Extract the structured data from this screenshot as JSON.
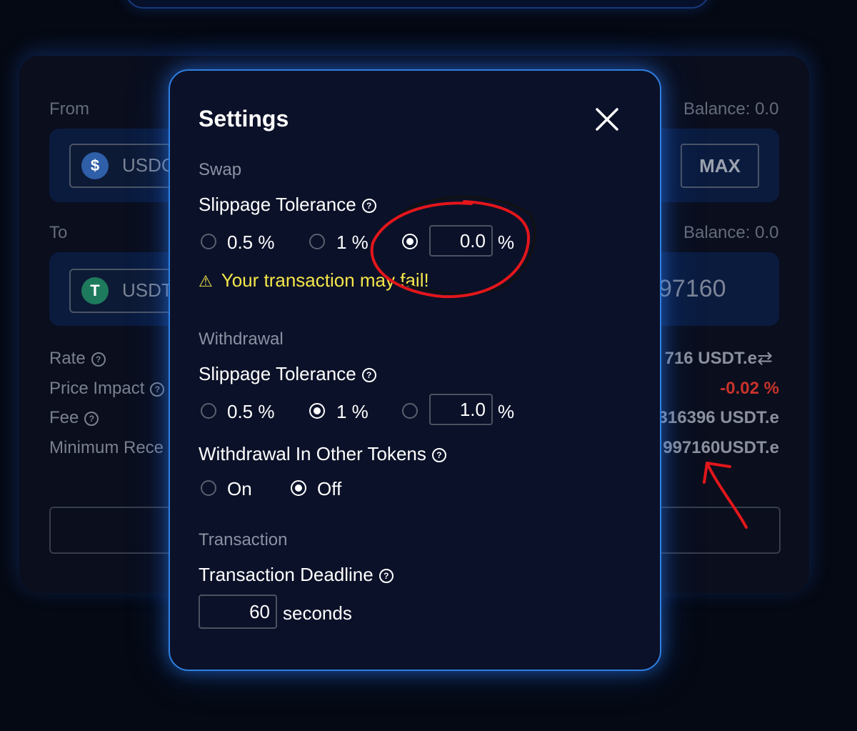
{
  "background_card": {
    "from_label": "From",
    "from_balance": "Balance: 0.0",
    "from_token": "USDC",
    "max_label": "MAX",
    "to_label": "To",
    "to_balance": "Balance: 0.0",
    "to_token": "USDT",
    "to_amount_visible": "97160",
    "rows": [
      {
        "label": "Rate",
        "value": "716 USDT.e"
      },
      {
        "label": "Price Impact",
        "value": "-0.02 %"
      },
      {
        "label": "Fee",
        "value": "316396 USDT.e"
      },
      {
        "label": "Minimum Rece",
        "value": "997160USDT.e"
      }
    ]
  },
  "modal": {
    "title": "Settings",
    "swap": {
      "section": "Swap",
      "label": "Slippage Tolerance",
      "options": [
        "0.5 %",
        "1 %"
      ],
      "selected": "custom",
      "custom_value": "0.0",
      "unit": "%",
      "warning": "Your transaction may fail!"
    },
    "withdrawal": {
      "section": "Withdrawal",
      "label": "Slippage Tolerance",
      "options": [
        "0.5 %",
        "1 %"
      ],
      "selected": "1 %",
      "custom_value": "1.0",
      "unit": "%",
      "other_tokens_label": "Withdrawal In Other Tokens",
      "other_tokens_options": [
        "On",
        "Off"
      ],
      "other_tokens_selected": "Off"
    },
    "transaction": {
      "section": "Transaction",
      "deadline_label": "Transaction Deadline",
      "deadline_value": "60",
      "deadline_unit": "seconds"
    }
  },
  "colors": {
    "modal_border": "#2f7fe0",
    "warning": "#f5e64a",
    "negative": "#c8332b",
    "annotation": "#e3161b"
  }
}
